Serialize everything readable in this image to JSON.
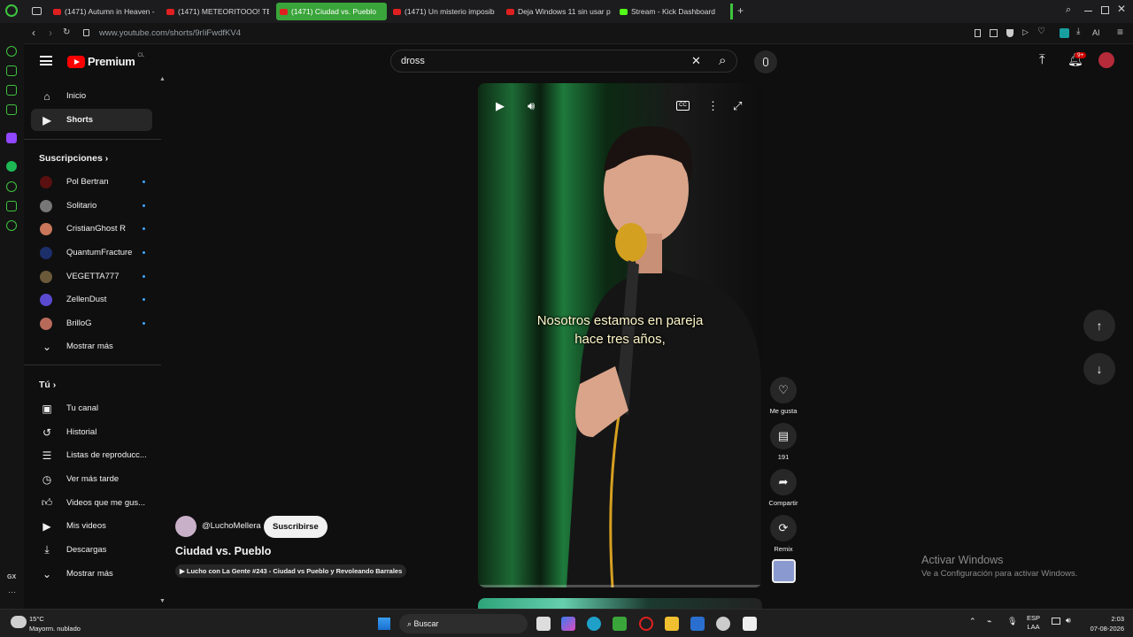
{
  "browser": {
    "tabs": [
      {
        "label": "(1471) Autumn in Heaven -"
      },
      {
        "label": "(1471) METEORITOOO! TE"
      },
      {
        "label": "(1471) Ciudad vs. Pueblo"
      },
      {
        "label": "(1471) Un misterio imposib"
      },
      {
        "label": "Deja Windows 11 sin usar p"
      },
      {
        "label": "Stream - Kick Dashboard"
      }
    ],
    "url": "www.youtube.com/shorts/9rIiFwdfKV4",
    "ai_label": "AI",
    "gx_label": "GX"
  },
  "youtube": {
    "logo": "Premium",
    "logo_region": "CL",
    "search_query": "dross",
    "notif_count": "9+",
    "sidebar": {
      "home": "Inicio",
      "shorts": "Shorts",
      "subs_title": "Suscripciones",
      "subs": [
        {
          "name": "Pol Bertran",
          "color": "#5a1010"
        },
        {
          "name": "Solitario",
          "color": "#777777"
        },
        {
          "name": "CristianGhost R",
          "color": "#c9765a"
        },
        {
          "name": "QuantumFracture",
          "color": "#1c2f6a"
        },
        {
          "name": "VEGETTA777",
          "color": "#6a5a3a"
        },
        {
          "name": "ZellenDust",
          "color": "#5a4ad0"
        },
        {
          "name": "BrilloG",
          "color": "#b86a5a"
        }
      ],
      "show_more_1": "Mostrar más",
      "you_title": "Tú",
      "you_items": [
        "Tu canal",
        "Historial",
        "Listas de reproducc...",
        "Ver más tarde",
        "Videos que me gus...",
        "Mis videos",
        "Descargas",
        "Mostrar más"
      ]
    },
    "short": {
      "caption_line1": "Nosotros estamos en pareja",
      "caption_line2": "hace tres años,",
      "channel": "@LuchoMellera",
      "subscribe": "Suscribirse",
      "title": "Ciudad vs. Pueblo",
      "playlist": "Lucho con La Gente #243 - Ciudad vs Pueblo y Revoleando Barrales",
      "like_label": "Me gusta",
      "comments": "191",
      "share_label": "Compartir",
      "remix_label": "Remix"
    }
  },
  "windows": {
    "activate_title": "Activar Windows",
    "activate_sub": "Ve a Configuración para activar Windows.",
    "weather_temp": "15°C",
    "weather_desc": "Mayorm. nublado",
    "search_label": "Buscar",
    "lang1": "ESP",
    "lang2": "LAA",
    "time": "2:03",
    "date": "07-08-2026"
  }
}
